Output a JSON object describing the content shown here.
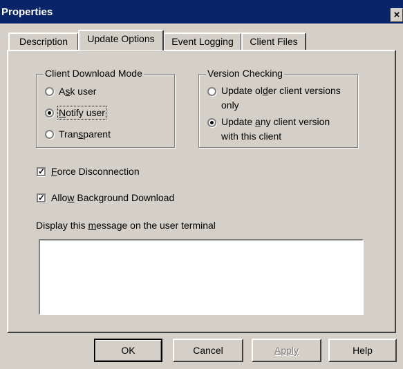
{
  "window": {
    "title": "Properties",
    "close_glyph": "×"
  },
  "tabs": [
    {
      "label": "Description",
      "active": false
    },
    {
      "label": "Update Options",
      "active": true
    },
    {
      "label": "Event Logging",
      "active": false
    },
    {
      "label": "Client Files",
      "active": false
    }
  ],
  "download_mode": {
    "title": "Client Download Mode",
    "options": [
      {
        "pre": "A",
        "accel": "s",
        "post": "k user",
        "selected": false
      },
      {
        "pre": "",
        "accel": "N",
        "post": "otify user",
        "selected": true
      },
      {
        "pre": "Tran",
        "accel": "s",
        "post": "parent",
        "selected": false
      }
    ]
  },
  "version_checking": {
    "title": "Version Checking",
    "options": [
      {
        "line1_pre": "Update ol",
        "line1_accel": "d",
        "line1_post": "er client versions",
        "line2": "only",
        "selected": false
      },
      {
        "line1_pre": "Update ",
        "line1_accel": "a",
        "line1_post": "ny client version",
        "line2": "with this client",
        "selected": true
      }
    ]
  },
  "checkboxes": [
    {
      "pre": "",
      "accel": "F",
      "post": "orce Disconnection",
      "checked": true
    },
    {
      "pre": "Allo",
      "accel": "w",
      "post": " Background Download",
      "checked": true
    }
  ],
  "message": {
    "label_pre": "Display this ",
    "label_accel": "m",
    "label_post": "essage on the user terminal",
    "value": ""
  },
  "buttons": {
    "ok": "OK",
    "cancel": "Cancel",
    "apply": "Apply",
    "help": "Help"
  },
  "check_glyph": "✓"
}
